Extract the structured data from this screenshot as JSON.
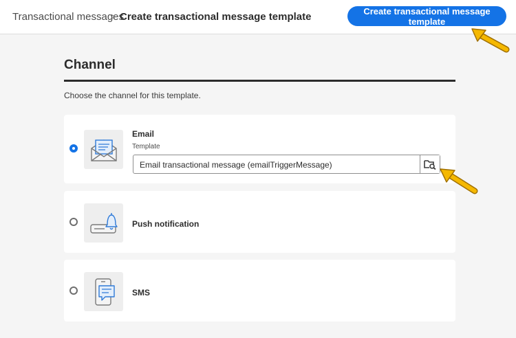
{
  "breadcrumb": {
    "root": "Transactional messages",
    "separator": ">",
    "current": "Create transactional message template"
  },
  "header": {
    "primary_button": "Create transactional message template"
  },
  "section": {
    "title": "Channel",
    "description": "Choose the channel for this template."
  },
  "channels": [
    {
      "label": "Email",
      "selected": true,
      "icon": "email-envelope-icon",
      "field_label": "Template",
      "field_value": "Email transactional message (emailTriggerMessage)",
      "browse_icon": "folder-search-icon"
    },
    {
      "label": "Push notification",
      "selected": false,
      "icon": "push-bell-icon"
    },
    {
      "label": "SMS",
      "selected": false,
      "icon": "sms-phone-icon"
    }
  ],
  "colors": {
    "accent": "#1473e6",
    "annotation_arrow": "#f5b800"
  }
}
